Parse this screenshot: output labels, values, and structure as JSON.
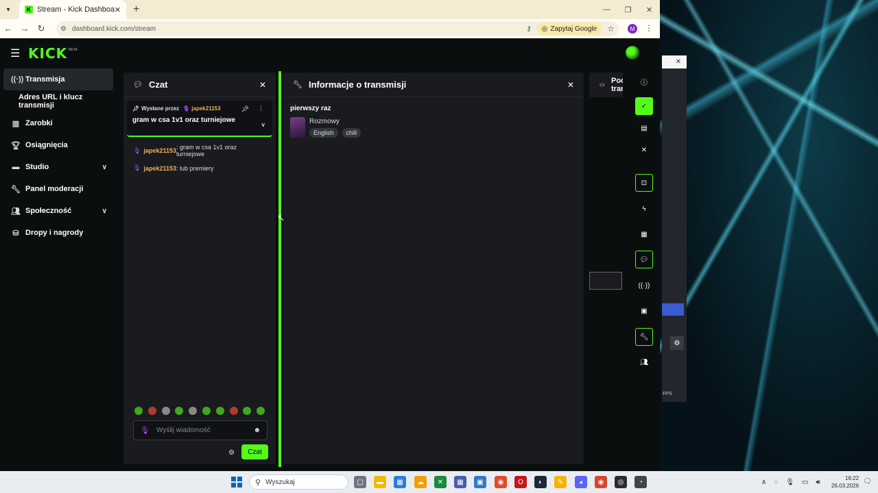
{
  "browser": {
    "tab_title": "Stream - Kick Dashboard",
    "url": "dashboard.kick.com/stream",
    "google_chip": "Zapytaj Google",
    "profile_initial": "M"
  },
  "app": {
    "logo": "KICK",
    "beta": "BETA"
  },
  "sidebar": {
    "items": [
      {
        "label": "Transmisja"
      },
      {
        "label": "Adres URL i klucz transmisji"
      },
      {
        "label": "Zarobki"
      },
      {
        "label": "Osiągnięcia"
      },
      {
        "label": "Studio"
      },
      {
        "label": "Panel moderacji"
      },
      {
        "label": "Społeczność"
      },
      {
        "label": "Dropy i nagrody"
      }
    ]
  },
  "chat": {
    "title": "Czat",
    "pinned": {
      "prefix": "Wysłane przez",
      "username": "japek21153",
      "message": "gram w csa 1v1 oraz turniejowe"
    },
    "messages": [
      {
        "username": "japek21153",
        "text": ": gram w csa 1v1 oraz turniejowe"
      },
      {
        "username": "japek21153",
        "text": ": lub premiery"
      }
    ],
    "input_placeholder": "Wyślij wiadomość",
    "send_label": "Czat"
  },
  "info": {
    "title": "Informacje o transmisji",
    "stream_title": "pierwszy raz",
    "category": "Rozmowy",
    "tags": [
      "English",
      "chill"
    ]
  },
  "third_panel": {
    "title_line1": "Poc",
    "title_line2": "trar"
  },
  "taskbar": {
    "search": "Wyszukaj",
    "time": "16:22",
    "date": "26.03.2026"
  }
}
